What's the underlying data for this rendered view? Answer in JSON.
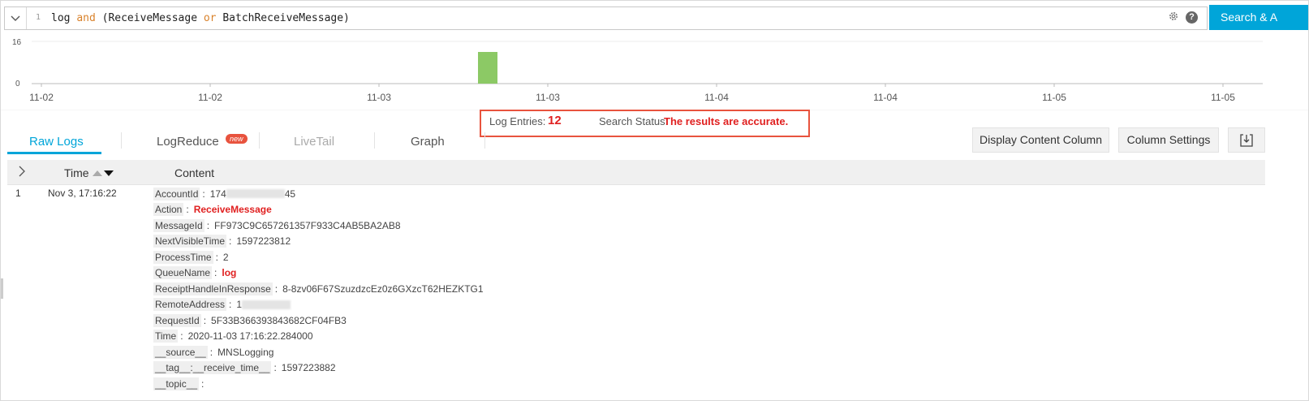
{
  "query": {
    "line_number": "1",
    "tokens": [
      {
        "text": "log ",
        "kind": "plain"
      },
      {
        "text": "and",
        "kind": "keyword"
      },
      {
        "text": " (ReceiveMessage ",
        "kind": "plain"
      },
      {
        "text": "or",
        "kind": "keyword"
      },
      {
        "text": " BatchReceiveMessage)",
        "kind": "plain"
      }
    ],
    "help_label": "?",
    "search_button_label": "Search & A"
  },
  "histogram": {
    "y_max_label": "16",
    "y_min_label": "0",
    "x_labels": [
      "11-02",
      "11-02",
      "11-03",
      "11-03",
      "11-04",
      "11-04",
      "11-05",
      "11-05"
    ],
    "bar_count": 12,
    "bar_color": "#8cc965"
  },
  "summary": {
    "entries_label": "Log Entries:",
    "entries_value": "12",
    "status_label": "Search Status:",
    "status_value": "The results are accurate."
  },
  "tabs": [
    {
      "label": "Raw Logs",
      "state": "active"
    },
    {
      "label": "LogReduce",
      "state": "normal",
      "badge": "new"
    },
    {
      "label": "LiveTail",
      "state": "disabled"
    },
    {
      "label": "Graph",
      "state": "normal"
    }
  ],
  "toolbar": {
    "display_content_column": "Display Content Column",
    "column_settings": "Column Settings"
  },
  "table": {
    "headers": {
      "time": "Time",
      "content": "Content"
    },
    "rows": [
      {
        "index": "1",
        "time": "Nov 3, 17:16:22",
        "fields": [
          {
            "key": "AccountId",
            "value_prefix": "174",
            "value_suffix": "45",
            "masked": true
          },
          {
            "key": "Action",
            "value": "ReceiveMessage",
            "highlight": true
          },
          {
            "key": "MessageId",
            "value": "FF973C9C657261357F933C4AB5BA2AB8"
          },
          {
            "key": "NextVisibleTime",
            "value": "1597223812"
          },
          {
            "key": "ProcessTime",
            "value": "2"
          },
          {
            "key": "QueueName",
            "value": "log",
            "highlight": true
          },
          {
            "key": "ReceiptHandleInResponse",
            "value": "8-8zv06F67SzuzdzcEz0z6GXzcT62HEZKTG1"
          },
          {
            "key": "RemoteAddress",
            "value_prefix": "1",
            "value_suffix": "",
            "masked": true
          },
          {
            "key": "RequestId",
            "value": "5F33B366393843682CF04FB3"
          },
          {
            "key": "Time",
            "value": "2020-11-03 17:16:22.284000"
          },
          {
            "key": "__source__",
            "value": "MNSLogging"
          },
          {
            "key": "__tag__:__receive_time__",
            "value": "1597223882"
          },
          {
            "key": "__topic__",
            "value": ""
          }
        ]
      }
    ]
  },
  "colors": {
    "accent": "#00a5d9",
    "highlight": "#e02020",
    "summary_border": "#e8533e"
  }
}
